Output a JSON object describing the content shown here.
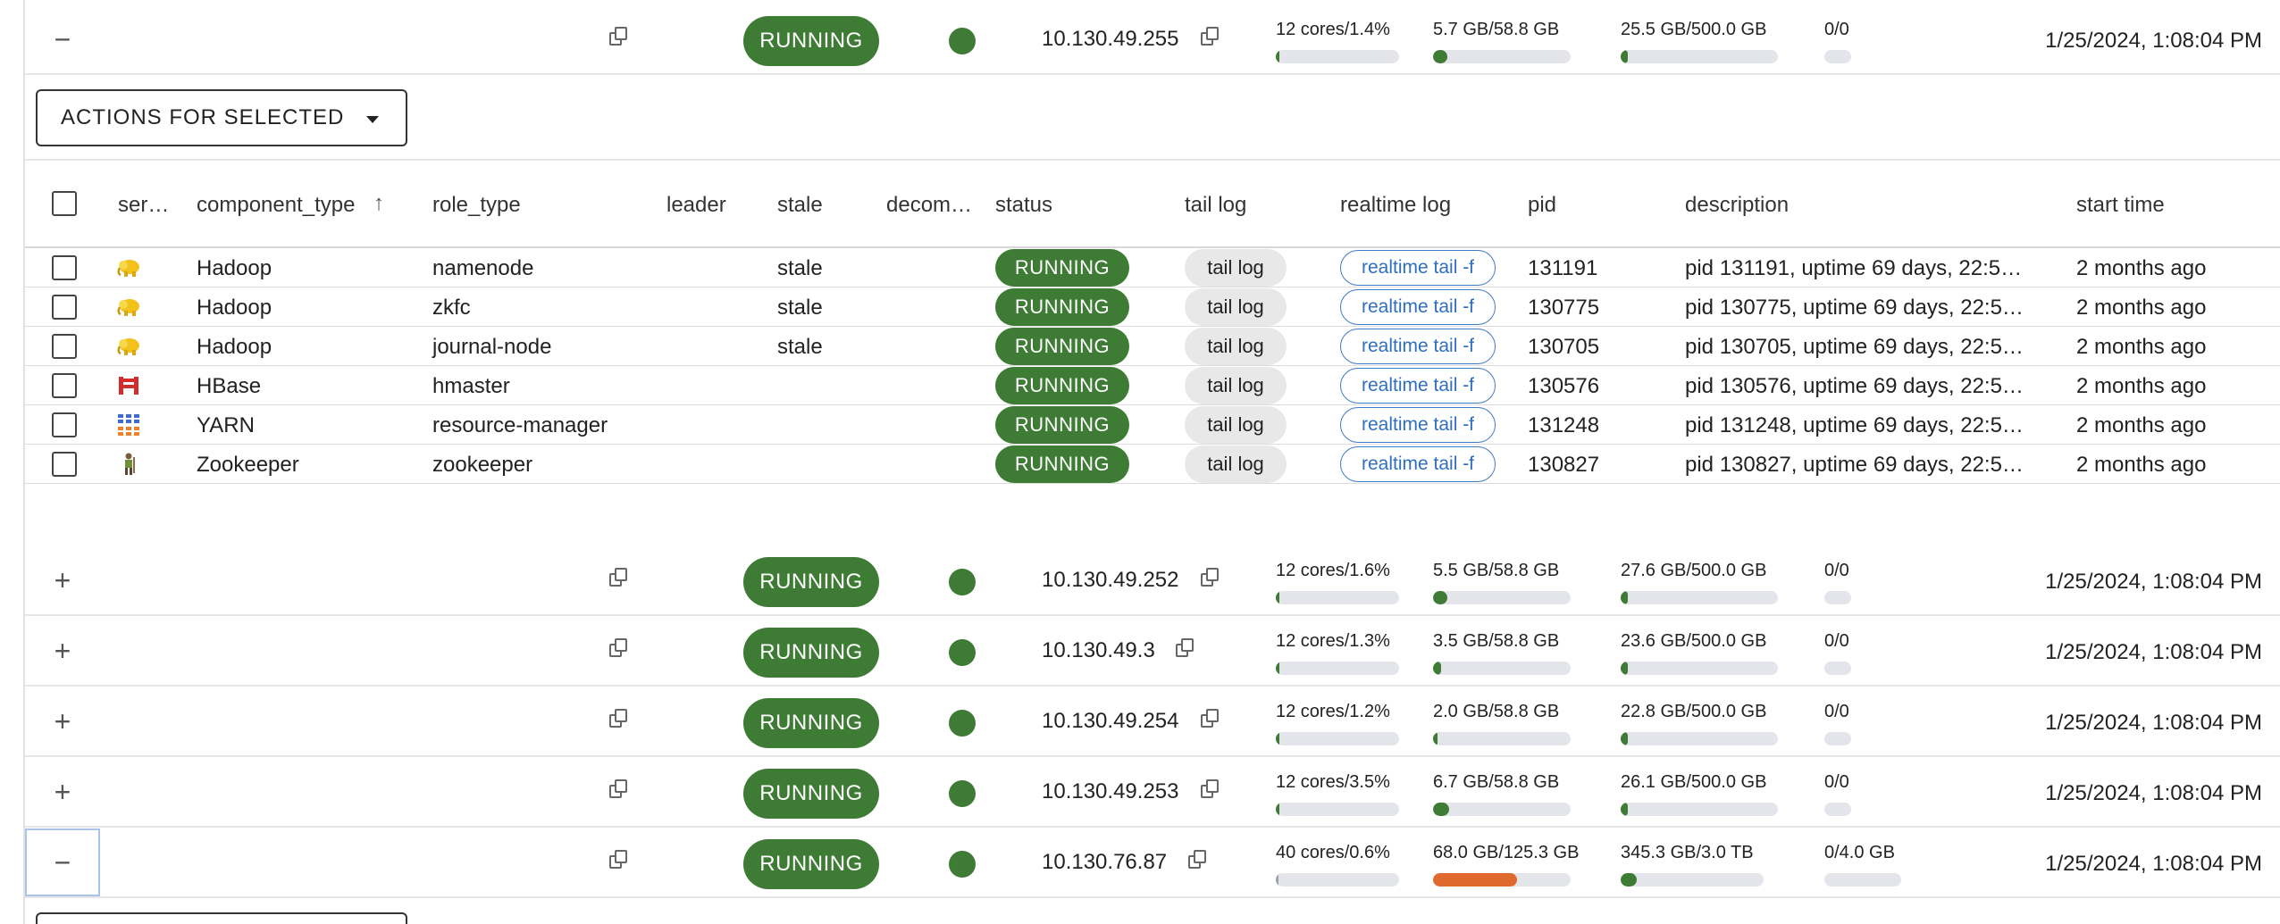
{
  "host_rows": [
    {
      "toggle": "−",
      "hostname": "",
      "status": "RUNNING",
      "ip": "10.130.49.255",
      "cpu": "12 cores/1.4%",
      "cpu_pct": 1.4,
      "mem": "5.7 GB/58.8 GB",
      "mem_pct": 9.7,
      "disk": "25.5 GB/500.0 GB",
      "disk_pct": 5.1,
      "swap": "0/0",
      "date": "1/25/2024, 1:08:04 PM"
    },
    {
      "toggle": "+",
      "hostname": "",
      "status": "RUNNING",
      "ip": "10.130.49.252",
      "cpu": "12 cores/1.6%",
      "cpu_pct": 1.6,
      "mem": "5.5 GB/58.8 GB",
      "mem_pct": 9.4,
      "disk": "27.6 GB/500.0 GB",
      "disk_pct": 5.5,
      "swap": "0/0",
      "date": "1/25/2024, 1:08:04 PM"
    },
    {
      "toggle": "+",
      "hostname": "",
      "status": "RUNNING",
      "ip": "10.130.49.3",
      "cpu": "12 cores/1.3%",
      "cpu_pct": 1.3,
      "mem": "3.5 GB/58.8 GB",
      "mem_pct": 6.0,
      "disk": "23.6 GB/500.0 GB",
      "disk_pct": 4.7,
      "swap": "0/0",
      "date": "1/25/2024, 1:08:04 PM"
    },
    {
      "toggle": "+",
      "hostname": "",
      "status": "RUNNING",
      "ip": "10.130.49.254",
      "cpu": "12 cores/1.2%",
      "cpu_pct": 1.2,
      "mem": "2.0 GB/58.8 GB",
      "mem_pct": 3.4,
      "disk": "22.8 GB/500.0 GB",
      "disk_pct": 4.6,
      "swap": "0/0",
      "date": "1/25/2024, 1:08:04 PM"
    },
    {
      "toggle": "+",
      "hostname": "",
      "status": "RUNNING",
      "ip": "10.130.49.253",
      "cpu": "12 cores/3.5%",
      "cpu_pct": 3.5,
      "mem": "6.7 GB/58.8 GB",
      "mem_pct": 11.4,
      "disk": "26.1 GB/500.0 GB",
      "disk_pct": 5.2,
      "swap": "0/0",
      "date": "1/25/2024, 1:08:04 PM"
    },
    {
      "toggle": "−",
      "hostname": "",
      "status": "RUNNING",
      "ip": "10.130.76.87",
      "cpu": "40 cores/0.6%",
      "cpu_pct": 0.6,
      "mem": "68.0 GB/125.3 GB",
      "mem_pct": 54.3,
      "disk": "345.3 GB/3.0 TB",
      "disk_pct": 11.2,
      "swap": "0/4.0 GB",
      "date": "1/25/2024, 1:08:04 PM"
    }
  ],
  "actions": {
    "label": "ACTIONS FOR SELECTED"
  },
  "component_table": {
    "headers": {
      "service": "ser…",
      "component_type": "component_type",
      "role_type": "role_type",
      "leader": "leader",
      "stale": "stale",
      "decom": "decom…",
      "status": "status",
      "tail_log": "tail log",
      "realtime_log": "realtime log",
      "pid": "pid",
      "description": "description",
      "start_time": "start time"
    },
    "rows": [
      {
        "icon": "hadoop-elephant-icon",
        "component": "Hadoop",
        "role": "namenode",
        "stale": "stale",
        "status": "RUNNING",
        "tail": "tail log",
        "realtime": "realtime tail -f",
        "pid": "131191",
        "description": "pid 131191, uptime 69 days, 22:5…",
        "start": "2 months ago"
      },
      {
        "icon": "hadoop-elephant-icon",
        "component": "Hadoop",
        "role": "zkfc",
        "stale": "stale",
        "status": "RUNNING",
        "tail": "tail log",
        "realtime": "realtime tail -f",
        "pid": "130775",
        "description": "pid 130775, uptime 69 days, 22:5…",
        "start": "2 months ago"
      },
      {
        "icon": "hadoop-elephant-icon",
        "component": "Hadoop",
        "role": "journal-node",
        "stale": "stale",
        "status": "RUNNING",
        "tail": "tail log",
        "realtime": "realtime tail -f",
        "pid": "130705",
        "description": "pid 130705, uptime 69 days, 22:5…",
        "start": "2 months ago"
      },
      {
        "icon": "hbase-icon",
        "component": "HBase",
        "role": "hmaster",
        "stale": "",
        "status": "RUNNING",
        "tail": "tail log",
        "realtime": "realtime tail -f",
        "pid": "130576",
        "description": "pid 130576, uptime 69 days, 22:5…",
        "start": "2 months ago"
      },
      {
        "icon": "yarn-icon",
        "component": "YARN",
        "role": "resource-manager",
        "stale": "",
        "status": "RUNNING",
        "tail": "tail log",
        "realtime": "realtime tail -f",
        "pid": "131248",
        "description": "pid 131248, uptime 69 days, 22:5…",
        "start": "2 months ago"
      },
      {
        "icon": "zookeeper-icon",
        "component": "Zookeeper",
        "role": "zookeeper",
        "stale": "",
        "status": "RUNNING",
        "tail": "tail log",
        "realtime": "realtime tail -f",
        "pid": "130827",
        "description": "pid 130827, uptime 69 days, 22:5…",
        "start": "2 months ago"
      }
    ]
  },
  "colors": {
    "running_green": "#3e7b34",
    "memory_orange": "#e0692d",
    "link_blue": "#2f6fbd"
  }
}
